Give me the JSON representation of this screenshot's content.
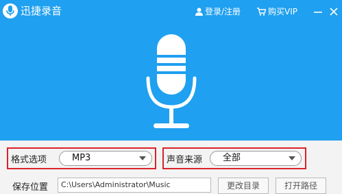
{
  "app": {
    "title": "迅捷录音"
  },
  "header": {
    "login_label": "登录/注册",
    "vip_label": "购买VIP"
  },
  "settings": {
    "format": {
      "label": "格式选项",
      "value": "MP3"
    },
    "source": {
      "label": "声音来源",
      "value": "全部"
    }
  },
  "save": {
    "label": "保存位置",
    "path": "C:\\Users\\Administrator\\Music",
    "change_label": "更改目录",
    "open_label": "打开路径"
  },
  "colors": {
    "header_bg": "#1fa0f0",
    "highlight_border": "#d9222a"
  }
}
